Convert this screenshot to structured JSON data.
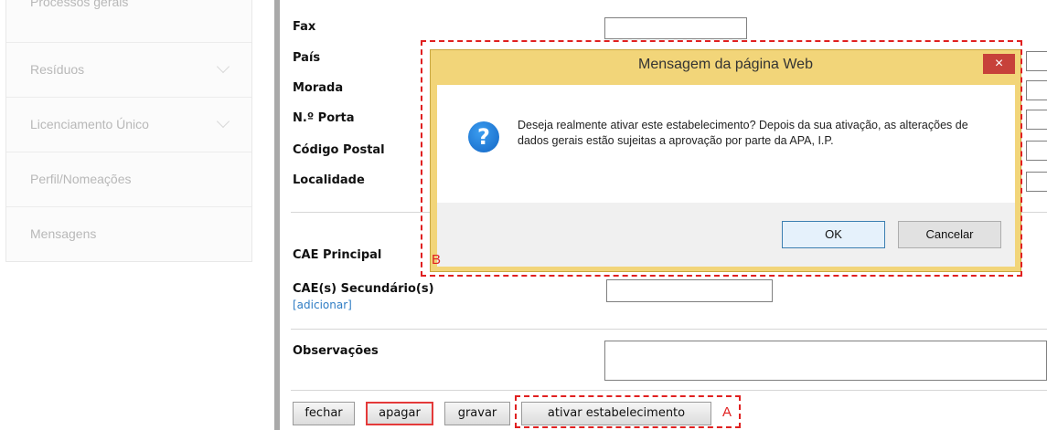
{
  "sidebar": {
    "items": [
      {
        "label": "Processos gerais",
        "chevron": false
      },
      {
        "label": "Resíduos",
        "chevron": true
      },
      {
        "label": "Licenciamento Único",
        "chevron": true
      },
      {
        "label": "Perfil/Nomeações",
        "chevron": false
      },
      {
        "label": "Mensagens",
        "chevron": false
      }
    ]
  },
  "form": {
    "fax_label": "Fax",
    "pais_label": "País",
    "morada_label": "Morada",
    "porta_label": "N.º Porta",
    "codigo_postal_label": "Código Postal",
    "localidade_label": "Localidade",
    "cae_principal_label": "CAE Principal",
    "cae_secundario_label": "CAE(s) Secundário(s)",
    "adicionar_link": "[adicionar]",
    "observacoes_label": "Observações"
  },
  "buttons": {
    "fechar": "fechar",
    "apagar": "apagar",
    "gravar": "gravar",
    "ativar": "ativar estabelecimento"
  },
  "annotations": {
    "a": "A",
    "b": "B",
    "color": "#e02020"
  },
  "dialog": {
    "title": "Mensagem da página Web",
    "close": "×",
    "icon": "question-icon",
    "message": "Deseja realmente ativar este estabelecimento? Depois da sua ativação, as alterações de dados gerais estão sujeitas a aprovação por parte da APA, I.P.",
    "ok": "OK",
    "cancel": "Cancelar"
  }
}
